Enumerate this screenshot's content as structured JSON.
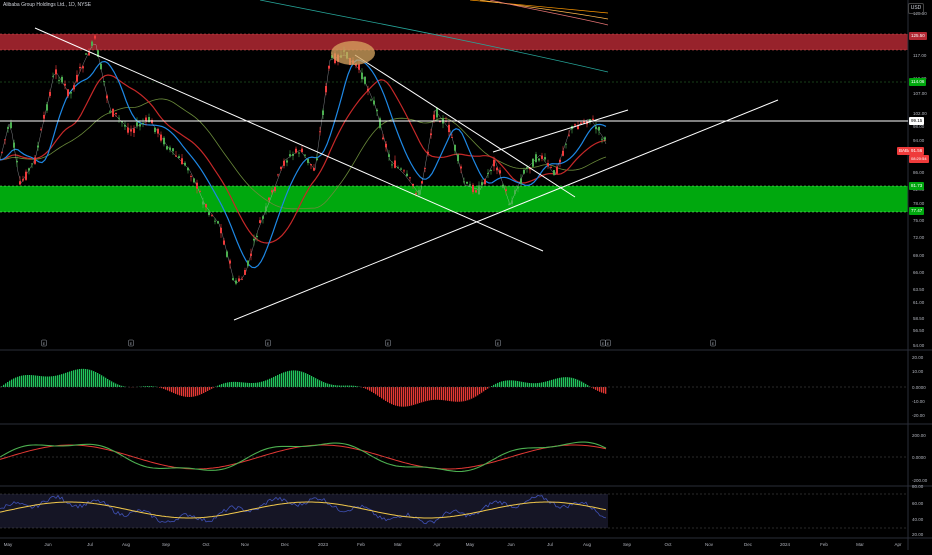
{
  "header": {
    "symbol_title": "Alibaba Group Holdings Ltd., 1D, NYSE",
    "currency": "USD"
  },
  "price_axis": {
    "ticks": [
      "128.00",
      "122.00",
      "117.00",
      "112.00",
      "107.00",
      "102.00",
      "98.00",
      "94.00",
      "90.00",
      "86.00",
      "82.00",
      "78.00",
      "75.00",
      "72.00",
      "69.00",
      "66.00",
      "63.50",
      "61.00",
      "58.50",
      "56.50",
      "54.00"
    ],
    "tags": {
      "resistance_top": "125.50",
      "green_tag": "114.06",
      "white_line": "99.15",
      "ticker": "BABA",
      "last_price": "91.56",
      "countdown": "08:20:54",
      "support_upper": "81.73",
      "support_lower": "77.47"
    }
  },
  "time_axis": {
    "labels": [
      "May",
      "Jun",
      "Jul",
      "Aug",
      "Sep",
      "Oct",
      "Nov",
      "Dec",
      "2023",
      "Feb",
      "Mar",
      "Apr",
      "May",
      "Jun",
      "Jul",
      "Aug",
      "Sep",
      "Oct",
      "Nov",
      "Dec",
      "2024",
      "Feb",
      "Mar",
      "Apr"
    ]
  },
  "event_markers": [
    "E",
    "E",
    "E",
    "E",
    "E",
    "E",
    "E",
    "E"
  ],
  "osc1_axis": [
    "20.00",
    "10.00",
    "0.0000",
    "-10.00",
    "-20.00"
  ],
  "osc2_axis": [
    "200.00",
    "0.0000",
    "-200.00"
  ],
  "osc3_axis": [
    "80.00",
    "60.00",
    "40.00",
    "20.00"
  ],
  "colors": {
    "background": "#000000",
    "resistance_zone": "#b22833",
    "support_zone": "#00a80e",
    "candle_up": "#4caf50",
    "candle_down": "#ef3b3b",
    "ma_red": "#c62828",
    "ma_blue": "#1e88e5",
    "ma_green": "#6a8a3a",
    "trendline": "#ffffff",
    "highlight_ellipse": "#d8a560"
  }
}
